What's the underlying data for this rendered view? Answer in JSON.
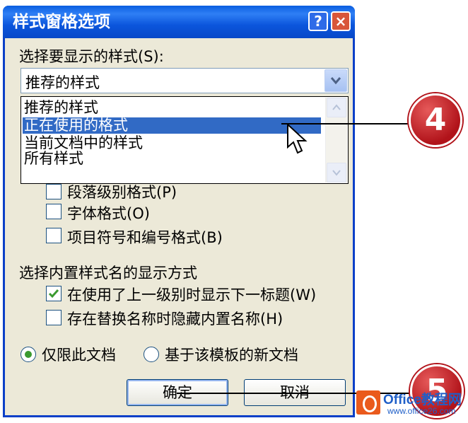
{
  "dialog": {
    "title": "样式窗格选项",
    "help_label": "?",
    "close_label": "×"
  },
  "select_label": "选择要显示的样式(S):",
  "combo": {
    "value": "推荐的样式"
  },
  "dropdown": {
    "options": [
      "推荐的样式",
      "正在使用的格式",
      "当前文档中的样式",
      "所有样式"
    ],
    "selected_index": 1
  },
  "format_checks": [
    {
      "label": "段落级别格式(P)",
      "checked": false
    },
    {
      "label": "字体格式(O)",
      "checked": false
    },
    {
      "label": "项目符号和编号格式(B)",
      "checked": false
    }
  ],
  "builtin_section_label": "选择内置样式名的显示方式",
  "builtin_checks": [
    {
      "label": "在使用了上一级别时显示下一标题(W)",
      "checked": true
    },
    {
      "label": "存在替换名称时隐藏内置名称(H)",
      "checked": false
    }
  ],
  "radios": [
    {
      "label": "仅限此文档",
      "selected": true
    },
    {
      "label": "基于该模板的新文档",
      "selected": false
    }
  ],
  "buttons": {
    "ok": "确定",
    "cancel": "取消"
  },
  "callouts": [
    {
      "label": "4"
    },
    {
      "label": "5"
    }
  ],
  "watermark": {
    "main": "Office教程网",
    "sub": "www.office26.com"
  },
  "colors": {
    "titlebar": "#0a5ee0",
    "dialog_bg": "#ece9d8",
    "selection": "#316ac5",
    "callout": "#b1131a",
    "check_green": "#3b9a2f"
  }
}
